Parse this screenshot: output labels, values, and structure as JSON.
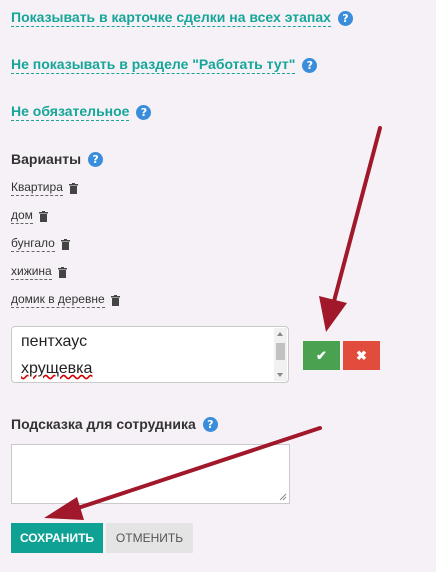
{
  "settings": {
    "show_on_all_stages": "Показывать в карточке сделки на всех этапах",
    "hide_in_work_here": "Не показывать в разделе \"Работать тут\"",
    "not_required": "Не обязательное"
  },
  "help_glyph": "?",
  "variants": {
    "title": "Варианты",
    "items": [
      "Квартира",
      "дом",
      "бунгало",
      "хижина",
      "домик в деревне"
    ]
  },
  "new_variants_input": {
    "lines": [
      "пентхаус",
      "хрущевка"
    ]
  },
  "hint": {
    "title": "Подсказка для сотрудника",
    "value": ""
  },
  "buttons": {
    "confirm_glyph": "✔",
    "discard_glyph": "✖",
    "save": "СОХРАНИТЬ",
    "cancel": "ОТМЕНИТЬ"
  },
  "colors": {
    "link": "#16a699",
    "help": "#3a8ddb",
    "confirm": "#4aa14f",
    "discard": "#e24c3c",
    "save": "#0fa294",
    "arrow": "#a0182a"
  },
  "icons": {
    "help": "question-circle-icon",
    "trash": "trash-icon",
    "confirm": "check-icon",
    "discard": "x-icon"
  }
}
